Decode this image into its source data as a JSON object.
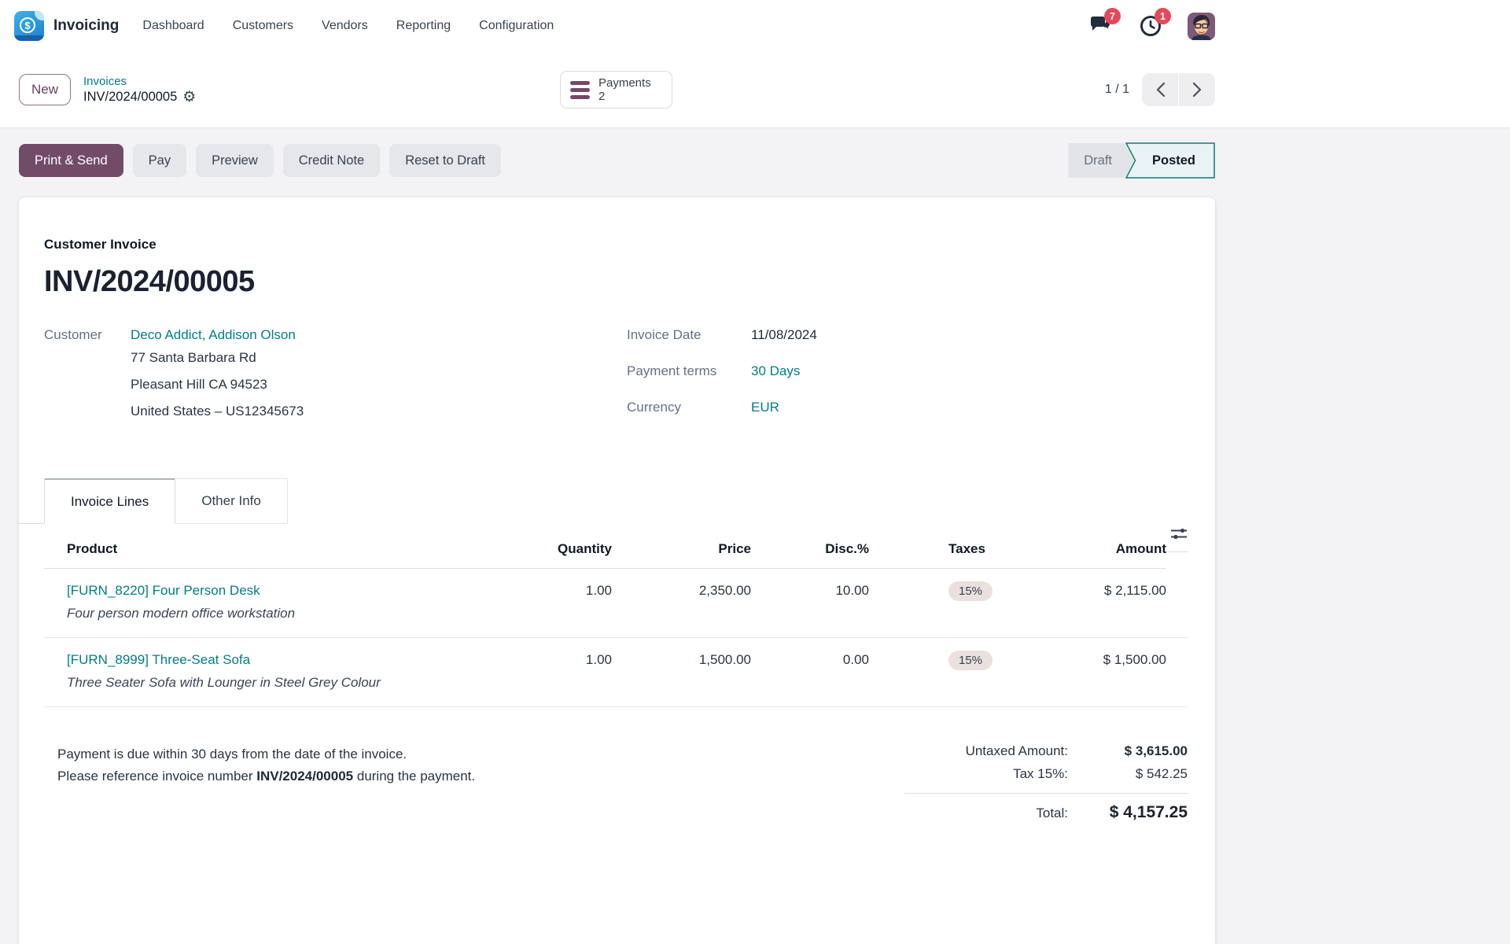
{
  "navbar": {
    "app_name": "Invoicing",
    "menu_items": [
      "Dashboard",
      "Customers",
      "Vendors",
      "Reporting",
      "Configuration"
    ],
    "messages_badge": "7",
    "activities_badge": "1"
  },
  "control_panel": {
    "new_button": "New",
    "breadcrumb_parent": "Invoices",
    "breadcrumb_current": "INV/2024/00005",
    "payments_button": {
      "label": "Payments",
      "count": "2"
    },
    "pager_value": "1 / 1"
  },
  "action_bar": {
    "print_send": "Print & Send",
    "pay": "Pay",
    "preview": "Preview",
    "credit_note": "Credit Note",
    "reset_to_draft": "Reset to Draft",
    "status_draft": "Draft",
    "status_posted": "Posted"
  },
  "invoice": {
    "type_label": "Customer Invoice",
    "number": "INV/2024/00005",
    "customer_label": "Customer",
    "customer_name": "Deco Addict, Addison Olson",
    "address": [
      "77 Santa Barbara Rd",
      "Pleasant Hill CA 94523",
      "United States – US12345673"
    ],
    "invoice_date_label": "Invoice Date",
    "invoice_date": "11/08/2024",
    "payment_terms_label": "Payment terms",
    "payment_terms": "30 Days",
    "currency_label": "Currency",
    "currency": "EUR",
    "tab_invoice_lines": "Invoice Lines",
    "tab_other_info": "Other Info"
  },
  "lines_table": {
    "headers": {
      "product": "Product",
      "quantity": "Quantity",
      "price": "Price",
      "discount": "Disc.%",
      "taxes": "Taxes",
      "amount": "Amount"
    },
    "rows": [
      {
        "product": "[FURN_8220] Four Person Desk",
        "description": "Four person modern office workstation",
        "quantity": "1.00",
        "price": "2,350.00",
        "discount": "10.00",
        "taxes": "15%",
        "amount": "$ 2,115.00"
      },
      {
        "product": "[FURN_8999] Three-Seat Sofa",
        "description": "Three Seater Sofa with Lounger in Steel Grey Colour",
        "quantity": "1.00",
        "price": "1,500.00",
        "discount": "0.00",
        "taxes": "15%",
        "amount": "$ 1,500.00"
      }
    ]
  },
  "footer": {
    "note_line1": "Payment is due within 30 days from the date of the invoice.",
    "note_line2_prefix": "Please reference invoice number ",
    "note_line2_bold": "INV/2024/00005",
    "note_line2_suffix": " during the payment.",
    "untaxed_label": "Untaxed Amount:",
    "untaxed_value": "$ 3,615.00",
    "tax_label": "Tax 15%:",
    "tax_value": "$ 542.25",
    "total_label": "Total:",
    "total_value": "$ 4,157.25"
  },
  "colors": {
    "primary": "#714B67",
    "link": "#017E84",
    "badge": "#E4485A",
    "posted_border": "#0E7D78"
  }
}
